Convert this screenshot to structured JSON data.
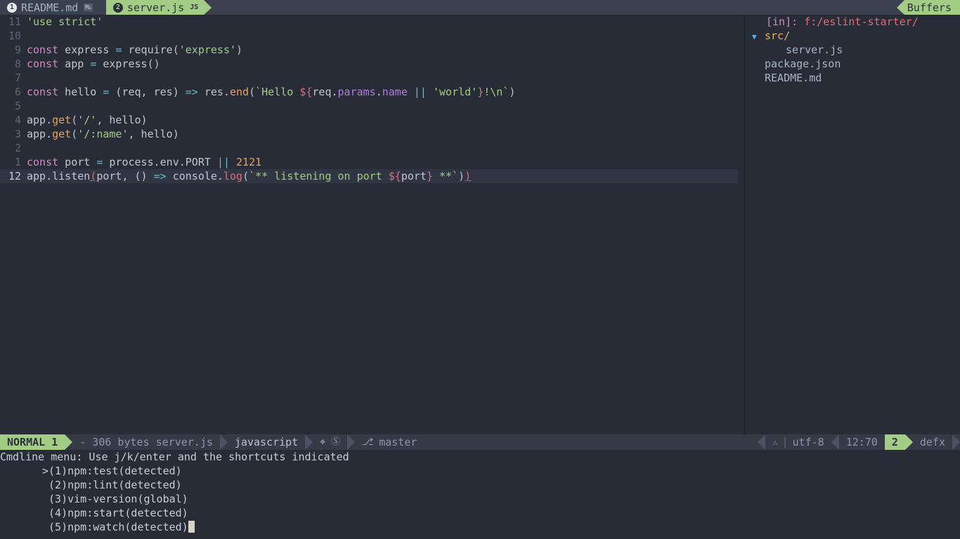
{
  "tabline": {
    "tabs": [
      {
        "number": "1",
        "label": "README.md",
        "badge": "M↓",
        "badge_type": "markdown-icon",
        "active": false
      },
      {
        "number": "2",
        "label": "server.js",
        "badge": "JS",
        "badge_type": "javascript-icon",
        "active": true
      }
    ],
    "right_label": "Buffers"
  },
  "editor": {
    "lines": [
      {
        "gutter": "11",
        "current": false,
        "tokens": [
          {
            "t": "'use strict'",
            "c": "str"
          }
        ]
      },
      {
        "gutter": "10",
        "current": false,
        "tokens": []
      },
      {
        "gutter": "9",
        "current": false,
        "tokens": [
          {
            "t": "const",
            "c": "kw"
          },
          {
            "t": " express ",
            "c": "ident"
          },
          {
            "t": "=",
            "c": "op"
          },
          {
            "t": " require",
            "c": "ident"
          },
          {
            "t": "(",
            "c": "punct"
          },
          {
            "t": "'express'",
            "c": "str"
          },
          {
            "t": ")",
            "c": "punct"
          }
        ]
      },
      {
        "gutter": "8",
        "current": false,
        "tokens": [
          {
            "t": "const",
            "c": "kw"
          },
          {
            "t": " app ",
            "c": "ident"
          },
          {
            "t": "=",
            "c": "op"
          },
          {
            "t": " express",
            "c": "ident"
          },
          {
            "t": "()",
            "c": "punct"
          }
        ]
      },
      {
        "gutter": "7",
        "current": false,
        "tokens": []
      },
      {
        "gutter": "6",
        "current": false,
        "tokens": [
          {
            "t": "const",
            "c": "kw"
          },
          {
            "t": " hello ",
            "c": "ident"
          },
          {
            "t": "=",
            "c": "op"
          },
          {
            "t": " (req, res) ",
            "c": "ident"
          },
          {
            "t": "=>",
            "c": "op"
          },
          {
            "t": " res.",
            "c": "ident"
          },
          {
            "t": "end",
            "c": "fn"
          },
          {
            "t": "(",
            "c": "punct"
          },
          {
            "t": "`Hello ",
            "c": "tmpl"
          },
          {
            "t": "${",
            "c": "tmplint"
          },
          {
            "t": "req.",
            "c": "ident"
          },
          {
            "t": "params",
            "c": "purp"
          },
          {
            "t": ".",
            "c": "ident"
          },
          {
            "t": "name",
            "c": "purp"
          },
          {
            "t": " ",
            "c": "ident"
          },
          {
            "t": "||",
            "c": "op"
          },
          {
            "t": " ",
            "c": "ident"
          },
          {
            "t": "'world'",
            "c": "str"
          },
          {
            "t": "}",
            "c": "tmplint"
          },
          {
            "t": "!\\n`",
            "c": "tmpl"
          },
          {
            "t": ")",
            "c": "punct"
          }
        ]
      },
      {
        "gutter": "5",
        "current": false,
        "tokens": []
      },
      {
        "gutter": "4",
        "current": false,
        "tokens": [
          {
            "t": "app.",
            "c": "ident"
          },
          {
            "t": "get",
            "c": "fn"
          },
          {
            "t": "(",
            "c": "punct"
          },
          {
            "t": "'/'",
            "c": "str"
          },
          {
            "t": ", hello)",
            "c": "ident"
          }
        ]
      },
      {
        "gutter": "3",
        "current": false,
        "tokens": [
          {
            "t": "app.",
            "c": "ident"
          },
          {
            "t": "get",
            "c": "fn"
          },
          {
            "t": "(",
            "c": "punct"
          },
          {
            "t": "'/:name'",
            "c": "str"
          },
          {
            "t": ", hello)",
            "c": "ident"
          }
        ]
      },
      {
        "gutter": "2",
        "current": false,
        "tokens": []
      },
      {
        "gutter": "1",
        "current": false,
        "tokens": [
          {
            "t": "const",
            "c": "kw"
          },
          {
            "t": " port ",
            "c": "ident"
          },
          {
            "t": "=",
            "c": "op"
          },
          {
            "t": " process.env.PORT ",
            "c": "ident"
          },
          {
            "t": "||",
            "c": "op"
          },
          {
            "t": " ",
            "c": "ident"
          },
          {
            "t": "2121",
            "c": "num"
          }
        ]
      },
      {
        "gutter": "12",
        "current": true,
        "tokens": [
          {
            "t": "app.",
            "c": "ident"
          },
          {
            "t": "listen",
            "c": "ident"
          },
          {
            "t": "(",
            "c": "matchp"
          },
          {
            "t": "port, () ",
            "c": "ident"
          },
          {
            "t": "=>",
            "c": "op"
          },
          {
            "t": " console.",
            "c": "ident"
          },
          {
            "t": "log",
            "c": "redfn"
          },
          {
            "t": "(",
            "c": "punct"
          },
          {
            "t": "`** listening on port ",
            "c": "tmpl"
          },
          {
            "t": "${",
            "c": "tmplint"
          },
          {
            "t": "port",
            "c": "ident"
          },
          {
            "t": "}",
            "c": "tmplint"
          },
          {
            "t": " **`",
            "c": "tmpl"
          },
          {
            "t": ")",
            "c": "punct"
          },
          {
            "t": ")",
            "c": "matchp"
          }
        ]
      }
    ]
  },
  "filetree": {
    "root_label": "[in]:",
    "root_path": "f:/eslint-starter/",
    "entries": [
      {
        "arrow": "▼",
        "name": "src/",
        "type": "dir",
        "indent": 0
      },
      {
        "arrow": "",
        "name": "server.js",
        "type": "file",
        "indent": 1
      },
      {
        "arrow": "",
        "name": "package.json",
        "type": "file",
        "indent": 0
      },
      {
        "arrow": "",
        "name": "README.md",
        "type": "file",
        "indent": 0
      }
    ]
  },
  "statusline": {
    "mode": "NORMAL 1",
    "filename": "- 306 bytes server.js",
    "filetype": "javascript",
    "icons": {
      "diamond": "❖",
      "signify": "Ⓢ"
    },
    "branch_icon": "⎇",
    "branch": "master",
    "warn_icon": "⚠",
    "divider": "|",
    "encoding": "utf-8",
    "position": "12:70",
    "right_winnum": "2",
    "right_name": "defx"
  },
  "cmdline": {
    "prompt": "Cmdline menu: Use j/k/enter and the shortcuts indicated",
    "items": [
      {
        "marker": ">",
        "text": "(1)npm:test(detected)"
      },
      {
        "marker": " ",
        "text": "(2)npm:lint(detected)"
      },
      {
        "marker": " ",
        "text": "(3)vim-version(global)"
      },
      {
        "marker": " ",
        "text": "(4)npm:start(detected)"
      },
      {
        "marker": " ",
        "text": "(5)npm:watch(detected)"
      }
    ]
  },
  "colors": {
    "background": "#272c36",
    "tabline_bg": "#3a404e",
    "accent_green": "#a3cc85",
    "statusline_bg": "#343a46",
    "cursorline": "#2f3542"
  }
}
